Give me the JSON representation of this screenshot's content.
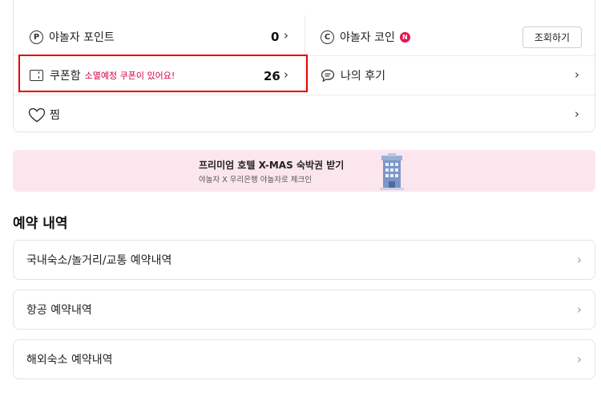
{
  "stats": {
    "points": {
      "label": "야놀자 포인트",
      "value": "0",
      "icon_letter": "P"
    },
    "coins": {
      "label": "야놀자 코인",
      "icon_letter": "C",
      "new_badge": "N",
      "button": "조회하기"
    },
    "coupons": {
      "label": "쿠폰함",
      "warning": "소멸예정 쿠폰이 있어요!",
      "count": "26"
    },
    "reviews": {
      "label": "나의 후기"
    },
    "wishlist": {
      "label": "찜"
    },
    "chevron": "›"
  },
  "banner": {
    "title": "프리미엄 호텔 X-MAS 숙박권 받기",
    "subtitle": "야놀자 X 우리은행 야놀자로 체크인",
    "background": "#fce6ee"
  },
  "reservations": {
    "title": "예약 내역",
    "items": [
      {
        "label": "국내숙소/놀거리/교통 예약내역"
      },
      {
        "label": "항공 예약내역"
      },
      {
        "label": "해외숙소 예약내역"
      }
    ]
  },
  "colors": {
    "highlight": "#e20000",
    "badge": "#e8124b",
    "warning": "#d6004c"
  }
}
